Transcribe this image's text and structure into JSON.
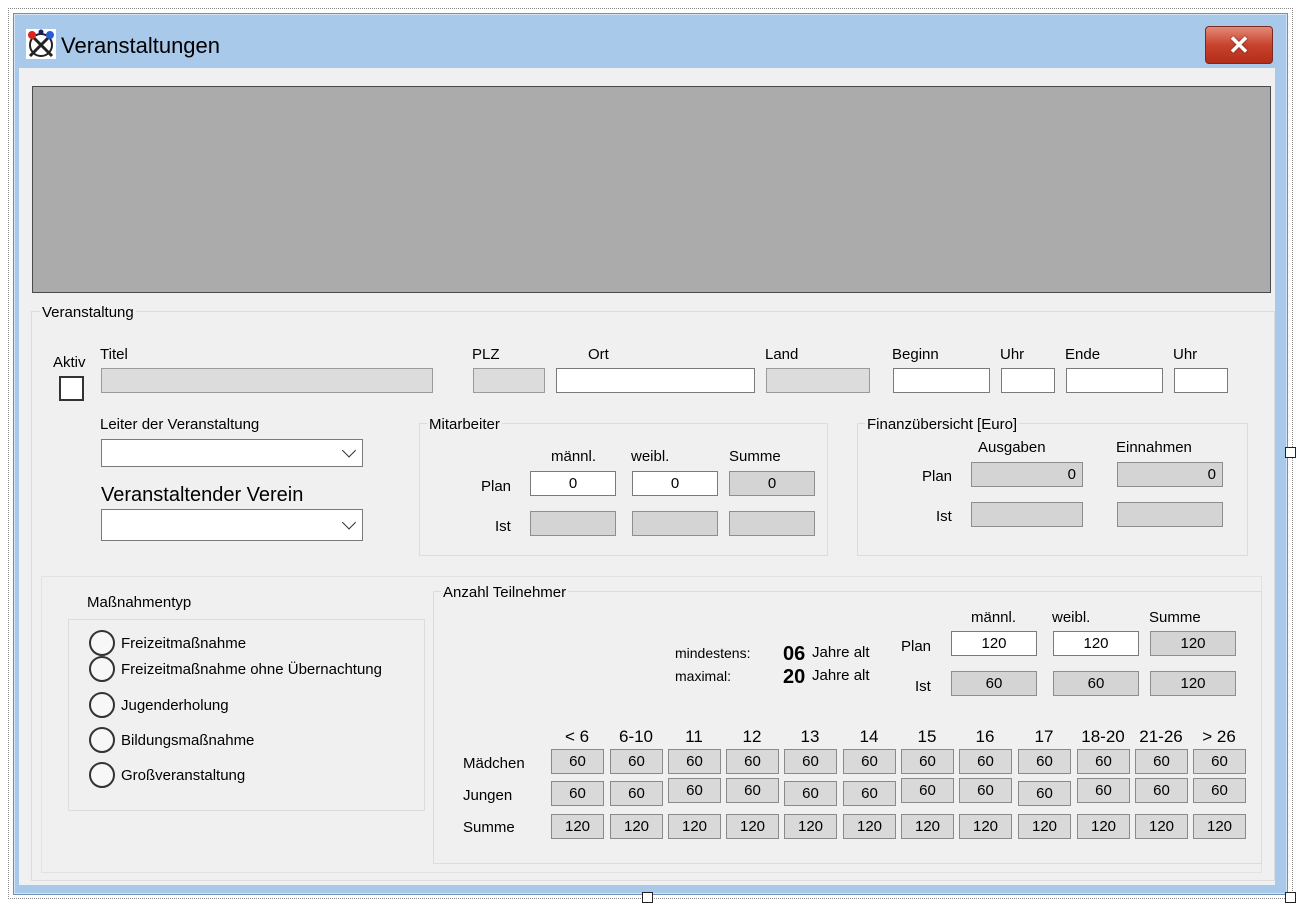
{
  "window": {
    "title": "Veranstaltungen",
    "close_icon": "close-icon"
  },
  "veranstaltung": {
    "group_label": "Veranstaltung",
    "aktiv_label": "Aktiv",
    "titel_label": "Titel",
    "plz_label": "PLZ",
    "ort_label": "Ort",
    "land_label": "Land",
    "beginn_label": "Beginn",
    "uhr1_label": "Uhr",
    "ende_label": "Ende",
    "uhr2_label": "Uhr",
    "leiter_label": "Leiter der Veranstaltung",
    "verein_label": "Veranstaltender Verein"
  },
  "mitarbeiter": {
    "group_label": "Mitarbeiter",
    "col_m": "männl.",
    "col_w": "weibl.",
    "col_s": "Summe",
    "row_plan": "Plan",
    "row_ist": "Ist",
    "plan_m": "0",
    "plan_w": "0",
    "plan_s": "0",
    "ist_m": "",
    "ist_w": "",
    "ist_s": ""
  },
  "finanz": {
    "group_label": "Finanzübersicht [Euro]",
    "col_a": "Ausgaben",
    "col_e": "Einnahmen",
    "row_plan": "Plan",
    "row_ist": "Ist",
    "plan_a": "0",
    "plan_e": "0",
    "ist_a": "",
    "ist_e": ""
  },
  "massnahmen": {
    "group_label": "Maßnahmentyp",
    "options": [
      "Freizeitmaßnahme",
      "Freizeitmaßnahme ohne Übernachtung",
      "Jugenderholung",
      "Bildungsmaßnahme",
      "Großveranstaltung"
    ]
  },
  "teilnehmer": {
    "group_label": "Anzahl Teilnehmer",
    "mindestens_label": "mindestens:",
    "maximal_label": "maximal:",
    "min_age": "06",
    "max_age": "20",
    "jahre_alt": "Jahre alt",
    "col_m": "männl.",
    "col_w": "weibl.",
    "col_s": "Summe",
    "row_plan": "Plan",
    "row_ist": "Ist",
    "plan_m": "120",
    "plan_w": "120",
    "plan_s": "120",
    "ist_m": "60",
    "ist_w": "60",
    "ist_s": "120",
    "age_groups": [
      "< 6",
      "6-10",
      "11",
      "12",
      "13",
      "14",
      "15",
      "16",
      "17",
      "18-20",
      "21-26",
      "> 26"
    ],
    "row_maedchen": "Mädchen",
    "row_jungen": "Jungen",
    "row_summe": "Summe",
    "maedchen": [
      "60",
      "60",
      "60",
      "60",
      "60",
      "60",
      "60",
      "60",
      "60",
      "60",
      "60",
      "60"
    ],
    "jungen": [
      "60",
      "60",
      "60",
      "60",
      "60",
      "60",
      "60",
      "60",
      "60",
      "60",
      "60",
      "60"
    ],
    "summe": [
      "120",
      "120",
      "120",
      "120",
      "120",
      "120",
      "120",
      "120",
      "120",
      "120",
      "120",
      "120"
    ]
  }
}
